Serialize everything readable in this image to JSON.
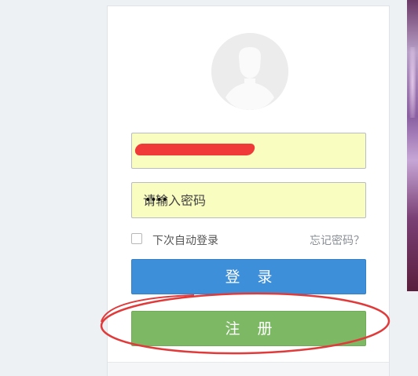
{
  "login_form": {
    "password_placeholder": "请输入密码",
    "password_masked": "••••",
    "remember_label": "下次自动登录",
    "forgot_link": "忘记密码？",
    "login_button": "登 录",
    "register_button": "注 册"
  },
  "colors": {
    "field_background": "#fafdc0",
    "login_button": "#3d8fd9",
    "register_button": "#7db964",
    "annotation_ellipse": "#e03a3a",
    "username_redaction": "#f03a3a"
  },
  "icons": {
    "avatar": "user-silhouette-icon"
  },
  "annotations": {
    "register_highlight": "red hand-drawn ellipse around register button",
    "username_redacted": true
  }
}
